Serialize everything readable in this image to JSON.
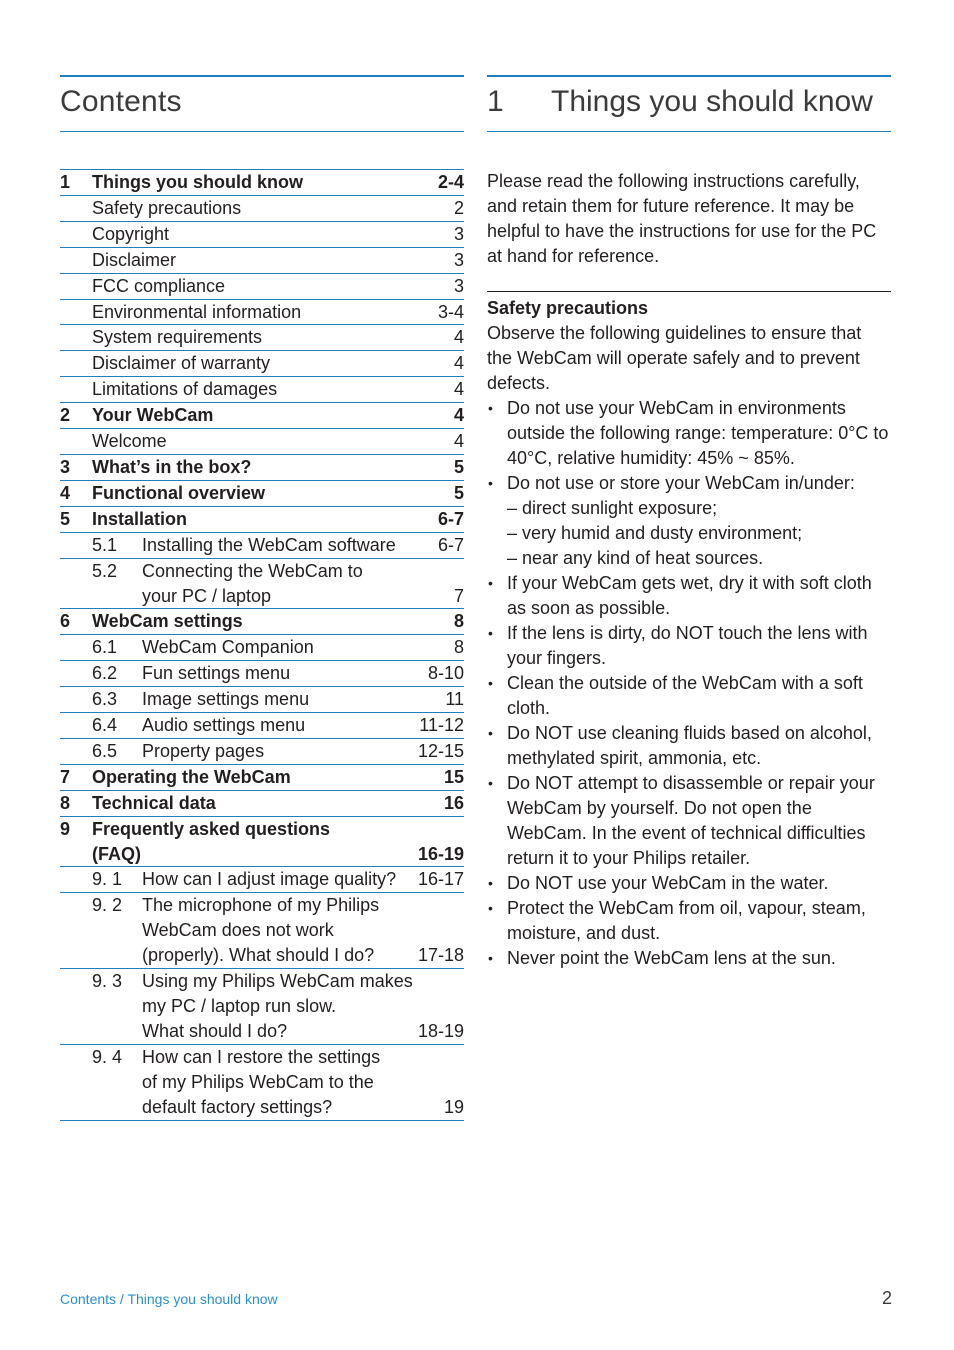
{
  "left": {
    "title": "Contents",
    "toc": [
      {
        "level": 1,
        "num": "1",
        "title": "Things you should know",
        "pages": "2-4"
      },
      {
        "level": 2,
        "title": "Safety precautions",
        "pages": "2"
      },
      {
        "level": 2,
        "title": "Copyright",
        "pages": "3"
      },
      {
        "level": 2,
        "title": "Disclaimer",
        "pages": "3"
      },
      {
        "level": 2,
        "title": "FCC compliance",
        "pages": "3"
      },
      {
        "level": 2,
        "title": "Environmental information",
        "pages": "3-4"
      },
      {
        "level": 2,
        "title": "System requirements",
        "pages": "4"
      },
      {
        "level": 2,
        "title": "Disclaimer of warranty",
        "pages": "4"
      },
      {
        "level": 2,
        "title": "Limitations of damages",
        "pages": "4"
      },
      {
        "level": 1,
        "num": "2",
        "title": "Your WebCam",
        "pages": "4"
      },
      {
        "level": 2,
        "title": "Welcome",
        "pages": "4"
      },
      {
        "level": 1,
        "num": "3",
        "title": "What’s in the box?",
        "pages": "5"
      },
      {
        "level": 1,
        "num": "4",
        "title": "Functional overview",
        "pages": "5"
      },
      {
        "level": 1,
        "num": "5",
        "title": "Installation",
        "pages": "6-7"
      },
      {
        "level": 3,
        "num": "5.1",
        "lines": [
          "Installing the WebCam software"
        ],
        "pages": "6-7"
      },
      {
        "level": 3,
        "num": "5.2",
        "lines": [
          "Connecting the WebCam to",
          "your PC / laptop"
        ],
        "pages": "7"
      },
      {
        "level": 1,
        "num": "6",
        "title": "WebCam settings",
        "pages": "8"
      },
      {
        "level": 3,
        "num": "6.1",
        "lines": [
          "WebCam Companion"
        ],
        "pages": "8"
      },
      {
        "level": 3,
        "num": "6.2",
        "lines": [
          "Fun settings menu"
        ],
        "pages": "8-10"
      },
      {
        "level": 3,
        "num": "6.3",
        "lines": [
          "Image settings menu"
        ],
        "pages": "11"
      },
      {
        "level": 3,
        "num": "6.4",
        "lines": [
          "Audio settings menu"
        ],
        "pages": "11-12"
      },
      {
        "level": 3,
        "num": "6.5",
        "lines": [
          "Property pages"
        ],
        "pages": "12-15"
      },
      {
        "level": 1,
        "num": "7",
        "title": "Operating the WebCam",
        "pages": "15"
      },
      {
        "level": 1,
        "num": "8",
        "title": "Technical data",
        "pages": "16"
      },
      {
        "level": 1,
        "num": "9",
        "lines": [
          "Frequently asked questions",
          "(FAQ)"
        ],
        "pages": "16-19"
      },
      {
        "level": 3,
        "num": "9. 1",
        "lines": [
          "How can I adjust image quality?"
        ],
        "pages": "16-17"
      },
      {
        "level": 3,
        "num": "9. 2",
        "lines": [
          "The microphone of my Philips",
          "WebCam does not work",
          "(properly). What should I do?"
        ],
        "pages": "17-18"
      },
      {
        "level": 3,
        "num": "9. 3",
        "lines": [
          "Using my Philips WebCam makes",
          "my PC / laptop run slow.",
          "What should I do?"
        ],
        "pages": "18-19"
      },
      {
        "level": 3,
        "num": "9. 4",
        "lines": [
          "How can I restore the settings",
          "of my  Philips WebCam to the",
          "default factory settings?"
        ],
        "pages": "19"
      }
    ]
  },
  "right": {
    "chapter_num": "1",
    "chapter_title": "Things you should know",
    "intro": "Please read the following instructions carefully, and retain them for future reference. It may be helpful to have the instructions for use for the PC at hand for reference.",
    "section_title": "Safety precautions",
    "section_intro": "Observe the following guidelines to ensure that the WebCam will operate safely and to prevent defects.",
    "bullets": [
      {
        "text": "Do not use your WebCam in environments outside the following range: temperature: 0°C to 40°C, relative humidity: 45% ~ 85%."
      },
      {
        "text": "Do not use or store your WebCam in/under:",
        "sub": [
          "– direct sunlight exposure;",
          "– very humid and dusty environment;",
          "– near any kind of heat sources."
        ]
      },
      {
        "text": "If your WebCam gets wet, dry it with soft cloth as soon as possible."
      },
      {
        "text": "If the lens is dirty, do NOT touch the lens with your fingers."
      },
      {
        "text": "Clean the outside of the WebCam with a soft cloth."
      },
      {
        "text": "Do NOT use cleaning fluids based on alcohol, methylated spirit, ammonia, etc."
      },
      {
        "text": "Do NOT attempt to disassemble or repair your WebCam by yourself. Do not open the WebCam. In the event of technical difficulties return it to your Philips retailer."
      },
      {
        "text": "Do NOT use your WebCam in the water."
      },
      {
        "text": "Protect the WebCam from oil, vapour, steam, moisture, and dust."
      },
      {
        "text": "Never point the WebCam lens at the sun."
      }
    ]
  },
  "footer": {
    "breadcrumb": "Contents / Things you should know",
    "page_number": "2"
  },
  "colors": {
    "accent": "#1d7fc1",
    "footer_text": "#2a8fd0",
    "body_text": "#231f20"
  }
}
